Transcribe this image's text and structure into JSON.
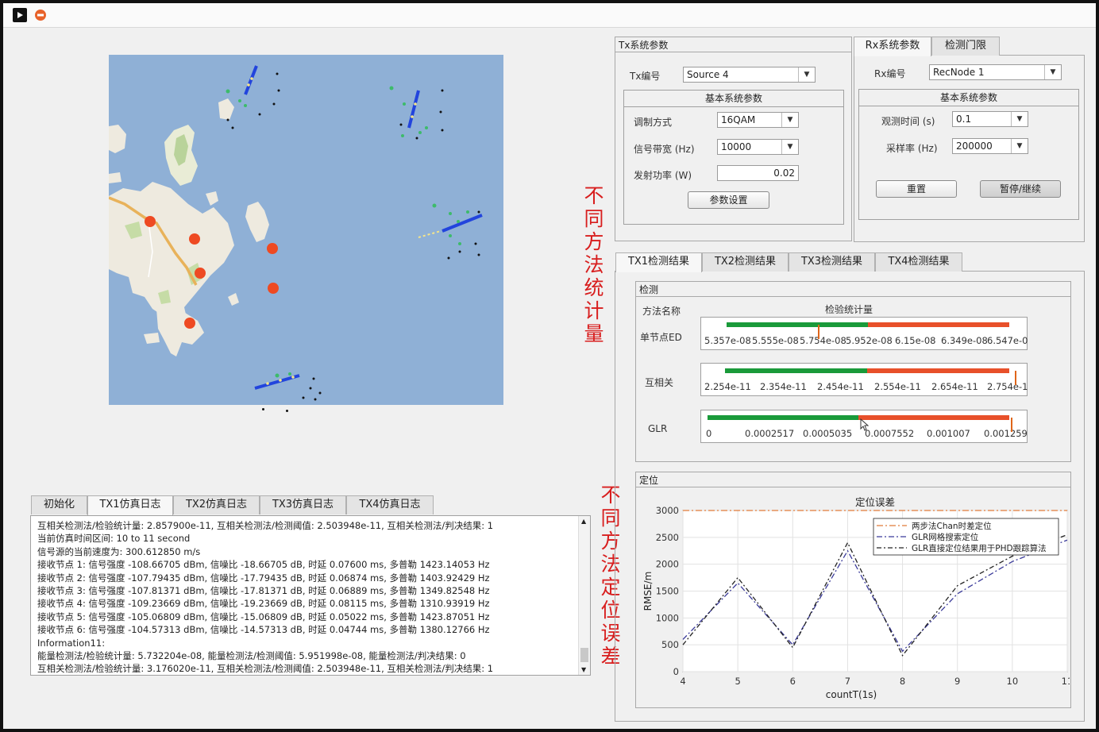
{
  "toolbar": {
    "run_icon": "play-icon",
    "stop_icon": "stop-icon"
  },
  "tx_panel": {
    "title": "Tx系统参数",
    "id_label": "Tx编号",
    "id_value": "Source 4",
    "basic_title": "基本系统参数",
    "mod_label": "调制方式",
    "mod_value": "16QAM",
    "bw_label": "信号带宽 (Hz)",
    "bw_value": "10000",
    "power_label": "发射功率 (W)",
    "power_value": "0.02",
    "set_button": "参数设置"
  },
  "rx_panel": {
    "tabs": [
      "Rx系统参数",
      "检测门限"
    ],
    "id_label": "Rx编号",
    "id_value": "RecNode 1",
    "basic_title": "基本系统参数",
    "obs_label": "观测时间 (s)",
    "obs_value": "0.1",
    "fs_label": "采样率 (Hz)",
    "fs_value": "200000",
    "reset_button": "重置",
    "pause_button": "暂停/继续"
  },
  "annotations": {
    "stat_text": "不同方法统计量",
    "loc_text": "不同方法定位误差"
  },
  "results": {
    "tabs": [
      "TX1检测结果",
      "TX2检测结果",
      "TX3检测结果",
      "TX4检测结果"
    ],
    "detect_title": "检测",
    "col_method": "方法名称",
    "col_stat": "检验统计量",
    "rows": [
      {
        "name": "单节点ED",
        "ticks": [
          "5.357e-08",
          "5.555e-08",
          "5.754e-08",
          "5.952e-08",
          "6.15e-08",
          "6.349e-08",
          "6.547e-0"
        ],
        "green_frac": 0.5,
        "needle_frac": 0.39
      },
      {
        "name": "互相关",
        "ticks": [
          "2.254e-11",
          "2.354e-11",
          "2.454e-11",
          "2.554e-11",
          "2.654e-11",
          "2.754e-1"
        ],
        "green_frac": 0.5,
        "needle_frac": 0.995
      },
      {
        "name": "GLR",
        "ticks": [
          "0",
          "0.0002517",
          "0.0005035",
          "0.0007552",
          "0.001007",
          "0.001259"
        ],
        "green_frac": 0.5,
        "needle_frac": 1.0
      }
    ],
    "loc_title": "定位"
  },
  "log": {
    "tabs": [
      "初始化",
      "TX1仿真日志",
      "TX2仿真日志",
      "TX3仿真日志",
      "TX4仿真日志"
    ],
    "lines": [
      "互相关检测法/检验统计量: 2.857900e-11, 互相关检测法/检测阈值: 2.503948e-11, 互相关检测法/判决结果: 1",
      "当前仿真时间区间: 10 to 11 second",
      "信号源的当前速度为: 300.612850 m/s",
      "接收节点 1: 信号强度 -108.66705 dBm, 信噪比 -18.66705 dB, 时延 0.07600 ms,   多普勒 1423.14053 Hz",
      "接收节点 2: 信号强度 -107.79435 dBm, 信噪比 -17.79435 dB, 时延 0.06874 ms,   多普勒 1403.92429 Hz",
      "接收节点 3: 信号强度 -107.81371 dBm, 信噪比 -17.81371 dB, 时延 0.06889 ms,   多普勒 1349.82548 Hz",
      "接收节点 4: 信号强度 -109.23669 dBm, 信噪比 -19.23669 dB, 时延 0.08115 ms,   多普勒 1310.93919 Hz",
      "接收节点 5: 信号强度 -105.06809 dBm, 信噪比 -15.06809 dB, 时延 0.05022 ms,   多普勒 1423.87051 Hz",
      "接收节点 6: 信号强度 -104.57313 dBm, 信噪比 -14.57313 dB, 时延 0.04744 ms,   多普勒 1380.12766 Hz",
      "Information11:",
      "能量检测法/检验统计量: 5.732204e-08, 能量检测法/检测阈值: 5.951998e-08, 能量检测法/判决结果: 0",
      "互相关检测法/检验统计量: 3.176020e-11, 互相关检测法/检测阈值: 2.503948e-11, 互相关检测法/判决结果: 1"
    ]
  },
  "chart_data": {
    "type": "line",
    "title": "定位误差",
    "xlabel": "countT(1s)",
    "ylabel": "RMSE/m",
    "xlim": [
      4,
      11
    ],
    "ylim": [
      0,
      3000
    ],
    "xticks": [
      4,
      5,
      6,
      7,
      8,
      9,
      10,
      11
    ],
    "yticks": [
      0,
      500,
      1000,
      1500,
      2000,
      2500,
      3000
    ],
    "grid": true,
    "legend_position": "top-right",
    "series": [
      {
        "name": "两步法Chan时差定位",
        "color": "#e07b39",
        "x": [
          4,
          5,
          6,
          7,
          8,
          9,
          10,
          11
        ],
        "y": [
          3000,
          3000,
          3000,
          3000,
          3000,
          3000,
          3000,
          3000
        ]
      },
      {
        "name": "GLR网格搜索定位",
        "color": "#3b3b9a",
        "x": [
          4,
          5,
          6,
          7,
          8,
          9,
          10,
          11
        ],
        "y": [
          600,
          1650,
          500,
          2250,
          380,
          1450,
          2050,
          2450
        ]
      },
      {
        "name": "GLR直接定位结果用于PHD跟踪算法",
        "color": "#222222",
        "x": [
          4,
          5,
          6,
          7,
          8,
          9,
          10,
          11
        ],
        "y": [
          500,
          1750,
          450,
          2400,
          300,
          1600,
          2150,
          2550
        ]
      }
    ]
  }
}
